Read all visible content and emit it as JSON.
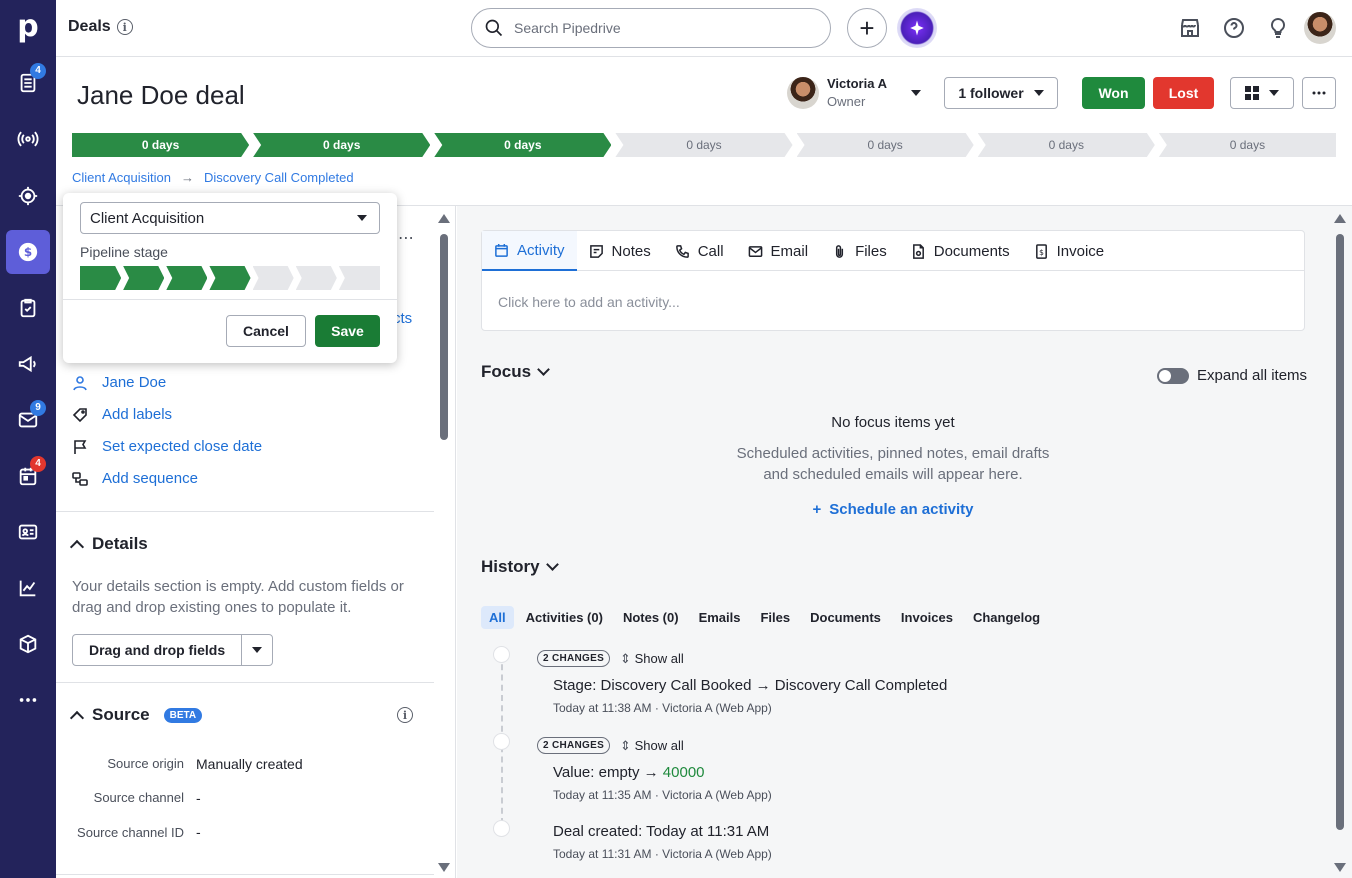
{
  "topbar": {
    "section_title": "Deals",
    "search_placeholder": "Search Pipedrive"
  },
  "rail": {
    "badges": {
      "leads": "4",
      "mail": "9",
      "calendar": "4"
    }
  },
  "deal": {
    "title": "Jane Doe deal",
    "owner_name": "Victoria A",
    "owner_role": "Owner",
    "follower_label": "1 follower",
    "won_label": "Won",
    "lost_label": "Lost",
    "stages": [
      "0 days",
      "0 days",
      "0 days",
      "0 days",
      "0 days",
      "0 days",
      "0 days"
    ],
    "stages_completed": 3,
    "breadcrumb": [
      "Client Acquisition",
      "Discovery Call Completed"
    ]
  },
  "popover": {
    "pipeline_value": "Client Acquisition",
    "stage_label": "Pipeline stage",
    "stage_count": 7,
    "stage_selected": 4,
    "cancel_label": "Cancel",
    "save_label": "Save"
  },
  "left": {
    "hidden_link_tail": "cts",
    "person": "Jane Doe",
    "add_labels": "Add labels",
    "close_date": "Set expected close date",
    "add_sequence": "Add sequence",
    "details_title": "Details",
    "details_empty": "Your details section is empty. Add custom fields or drag and drop existing ones to populate it.",
    "drag_drop_label": "Drag and drop fields",
    "source_title": "Source",
    "beta_label": "BETA",
    "source_rows": [
      {
        "key": "Source origin",
        "value": "Manually created"
      },
      {
        "key": "Source channel",
        "value": "-"
      },
      {
        "key": "Source channel ID",
        "value": "-"
      }
    ]
  },
  "right": {
    "tabs": [
      "Activity",
      "Notes",
      "Call",
      "Email",
      "Files",
      "Documents",
      "Invoice"
    ],
    "composer_placeholder": "Click here to add an activity...",
    "focus_title": "Focus",
    "expand_label": "Expand all items",
    "no_focus": "No focus items yet",
    "focus_desc_1": "Scheduled activities, pinned notes, email drafts",
    "focus_desc_2": "and scheduled emails will appear here.",
    "schedule_label": "Schedule an activity",
    "history_title": "History",
    "history_tabs": [
      "All",
      "Activities (0)",
      "Notes (0)",
      "Emails",
      "Files",
      "Documents",
      "Invoices",
      "Changelog"
    ],
    "history": [
      {
        "changes": "2 CHANGES",
        "show_all": "Show all",
        "label": "Stage",
        "value": "Discovery Call Booked → Discovery Call Completed",
        "meta": "Today at 11:38 AM · Victoria A (Web App)"
      },
      {
        "changes": "2 CHANGES",
        "show_all": "Show all",
        "label": "Value",
        "value_prefix": "empty →",
        "value_highlight": "40000",
        "meta": "Today at 11:35 AM · Victoria A (Web App)"
      },
      {
        "label": "Deal created",
        "value": "Today at 11:31 AM",
        "meta": "Today at 11:31 AM · Victoria A (Web App)"
      }
    ]
  },
  "colors": {
    "rail": "#23235b",
    "rail_active": "#5e5ed9",
    "stage_done": "#2a8b45",
    "won": "#1f8a3d",
    "lost": "#e2372e",
    "link": "#1e6fd6"
  },
  "icons": [
    "pipedrive-logo-icon",
    "info-icon",
    "search-icon",
    "plus-icon",
    "ai-sparkle-icon",
    "marketplace-icon",
    "help-icon",
    "lightbulb-icon",
    "user-avatar"
  ]
}
